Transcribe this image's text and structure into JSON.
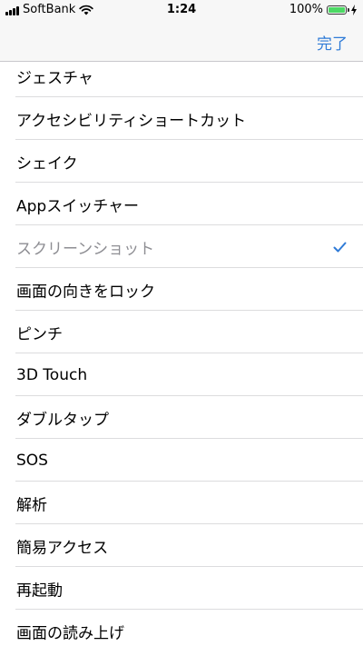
{
  "status_bar": {
    "carrier": "SoftBank",
    "time": "1:24",
    "battery_percent": "100%",
    "battery_level": 1.0
  },
  "navbar": {
    "done_label": "完了",
    "accent_color": "#2f7bd7"
  },
  "list": {
    "items": [
      {
        "label": "ジェスチャ"
      },
      {
        "label": "アクセシビリティショートカット"
      },
      {
        "label": "シェイク"
      },
      {
        "label": "Appスイッチャー"
      },
      {
        "label": "スクリーンショット",
        "checked": true,
        "disabled": true
      },
      {
        "label": "画面の向きをロック"
      },
      {
        "label": "ピンチ"
      },
      {
        "label": "3D Touch"
      },
      {
        "label": "ダブルタップ"
      },
      {
        "label": "SOS"
      },
      {
        "label": "解析"
      },
      {
        "label": "簡易アクセス"
      },
      {
        "label": "再起動"
      },
      {
        "label": "画面の読み上げ"
      }
    ]
  }
}
